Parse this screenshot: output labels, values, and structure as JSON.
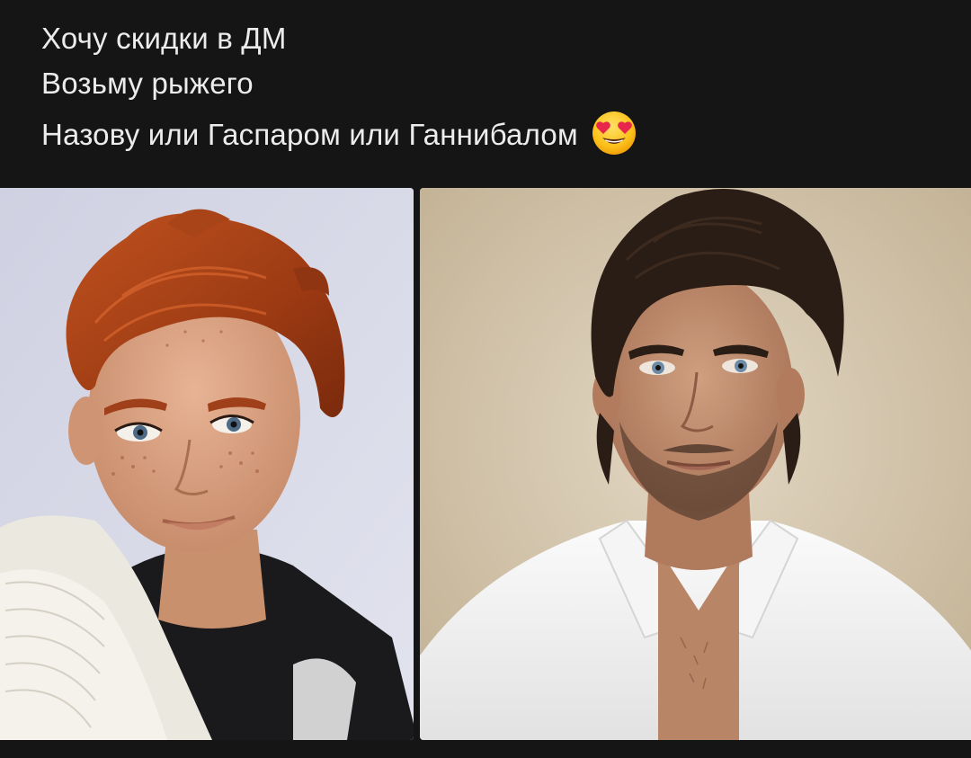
{
  "post": {
    "lines": [
      "Хочу скидки в ДМ",
      "Возьму рыжего",
      "Назову или Гаспаром или Ганнибалом"
    ],
    "emoji": "smiling-face-with-heart-eyes"
  },
  "photos": {
    "left": {
      "subject": "doll"
    },
    "right": {
      "subject": "man"
    }
  },
  "colors": {
    "background": "#151515",
    "text": "#ececec"
  }
}
